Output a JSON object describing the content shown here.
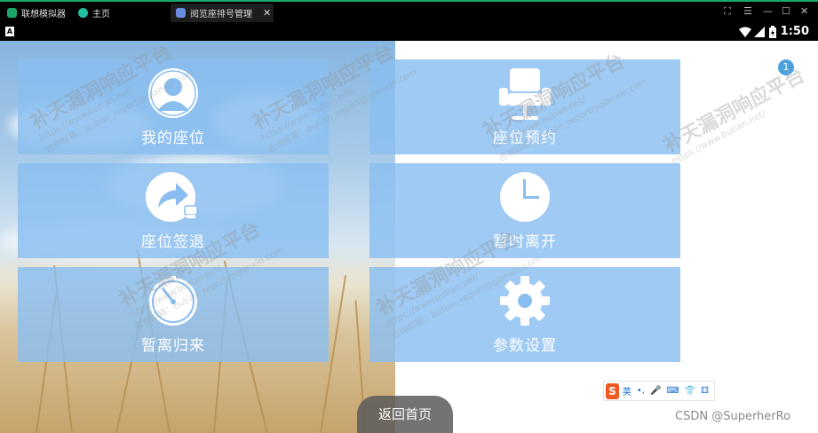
{
  "emulator": {
    "tabs": [
      {
        "label": "联想模拟器",
        "color": "#1aa86a"
      },
      {
        "label": "主页",
        "color": "#21c0a0"
      },
      {
        "label": "阅览座排号管理",
        "color": "#6b8de0"
      }
    ],
    "close_glyph": "✕",
    "window_controls": [
      "⛶",
      "☰",
      "—",
      "☐",
      "✕"
    ]
  },
  "status_bar": {
    "app_icon_letter": "A",
    "time": "1:50"
  },
  "tiles": [
    {
      "id": "my-seat",
      "label": "我的座位",
      "icon": "user-avatar-icon"
    },
    {
      "id": "seat-reserve",
      "label": "座位预约",
      "icon": "chair-icon"
    },
    {
      "id": "seat-checkout",
      "label": "座位签退",
      "icon": "share-arrow-icon"
    },
    {
      "id": "temp-leave",
      "label": "暂时离开",
      "icon": "clock-icon"
    },
    {
      "id": "temp-return",
      "label": "暂离归来",
      "icon": "stopwatch-icon"
    },
    {
      "id": "settings",
      "label": "参数设置",
      "icon": "gear-icon"
    }
  ],
  "badge": "1",
  "ime_bar": {
    "logo": "S",
    "lang": "英",
    "items": [
      "•,",
      "🎤",
      "⌨",
      "👕",
      "⚃"
    ]
  },
  "home_button": "返回首页",
  "footer_watermark": "CSDN @SuperherRo",
  "overlay_watermark": {
    "title": "补天漏洞响应平台",
    "sub": "https://www.butian.net/",
    "mail": "咨询邮箱：butian_report@qianxin.com"
  },
  "colors": {
    "tile": "#8abef0",
    "accent": "#1aa86a",
    "badge": "#4aa3df"
  }
}
